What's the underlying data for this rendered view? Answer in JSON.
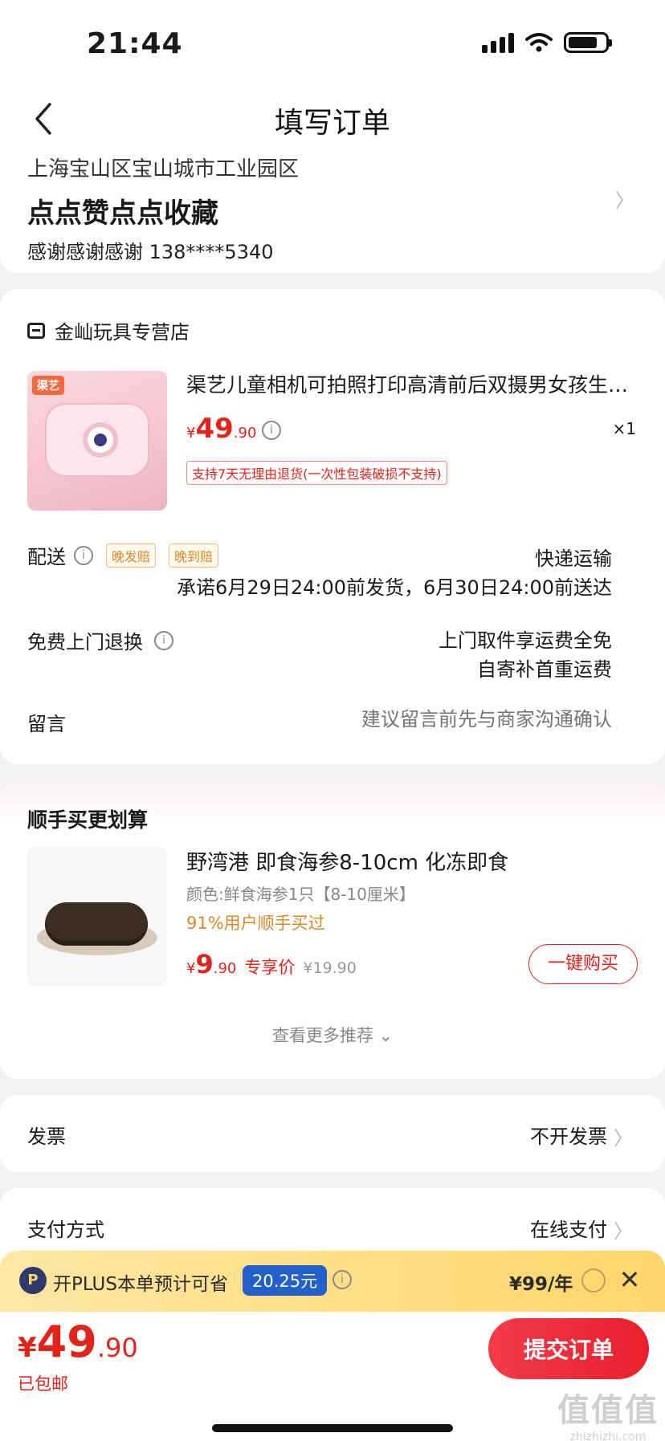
{
  "status_bar": {
    "time": "21:44"
  },
  "nav": {
    "title": "填写订单"
  },
  "address": {
    "region": "上海宝山区宝山城市工业园区",
    "detail": "点点赞点点收藏",
    "contact": "感谢感谢感谢  138****5340"
  },
  "order": {
    "shop_name": "金屾玩具专营店",
    "product": {
      "badge": "渠艺",
      "title": "渠艺儿童相机可拍照打印高清前后双摄男女孩生日礼物",
      "price_currency": "¥",
      "price_int": "49",
      "price_dec": ".90",
      "qty": "×1",
      "return_policy": "支持7天无理由退货(一次性包装破损不支持)"
    },
    "delivery": {
      "label": "配送",
      "tag_late_ship": "晚发赔",
      "tag_late_arrive": "晚到赔",
      "method": "快递运输",
      "promise": "承诺6月29日24:00前发货，6月30日24:00前送达"
    },
    "free_return": {
      "label": "免费上门退换",
      "line1": "上门取件享运费全免",
      "line2": "自寄补首重运费"
    },
    "message": {
      "label": "留言",
      "placeholder": "建议留言前先与商家沟通确认"
    }
  },
  "recommend": {
    "title": "顺手买更划算",
    "item": {
      "name": "野湾港 即食海参8-10cm 化冻即食",
      "spec": "颜色:鲜食海参1只【8-10厘米】",
      "social": "91%用户顺手买过",
      "price_currency": "¥",
      "price_int": "9",
      "price_dec": ".90",
      "exclusive_label": "专享价",
      "original_price": "¥19.90",
      "buy_label": "一键购买"
    },
    "more_label": "查看更多推荐 ⌄"
  },
  "invoice": {
    "label": "发票",
    "value": "不开发票"
  },
  "payment": {
    "label": "支付方式",
    "value": "在线支付"
  },
  "plus": {
    "logo": "P",
    "text": "开PLUS本单预计可省",
    "saving": "20.25元",
    "price": "¥99/年"
  },
  "bottom": {
    "total_currency": "¥",
    "total_int": "49",
    "total_dec": ".90",
    "shipping_note": "已包邮",
    "submit_label": "提交订单"
  },
  "watermark": {
    "big": "值值值",
    "small": "zhizhizhi.com"
  },
  "colors": {
    "accent": "#e2231a",
    "plus_blue": "#2360c9",
    "plus_gold": "#ffd66a"
  }
}
